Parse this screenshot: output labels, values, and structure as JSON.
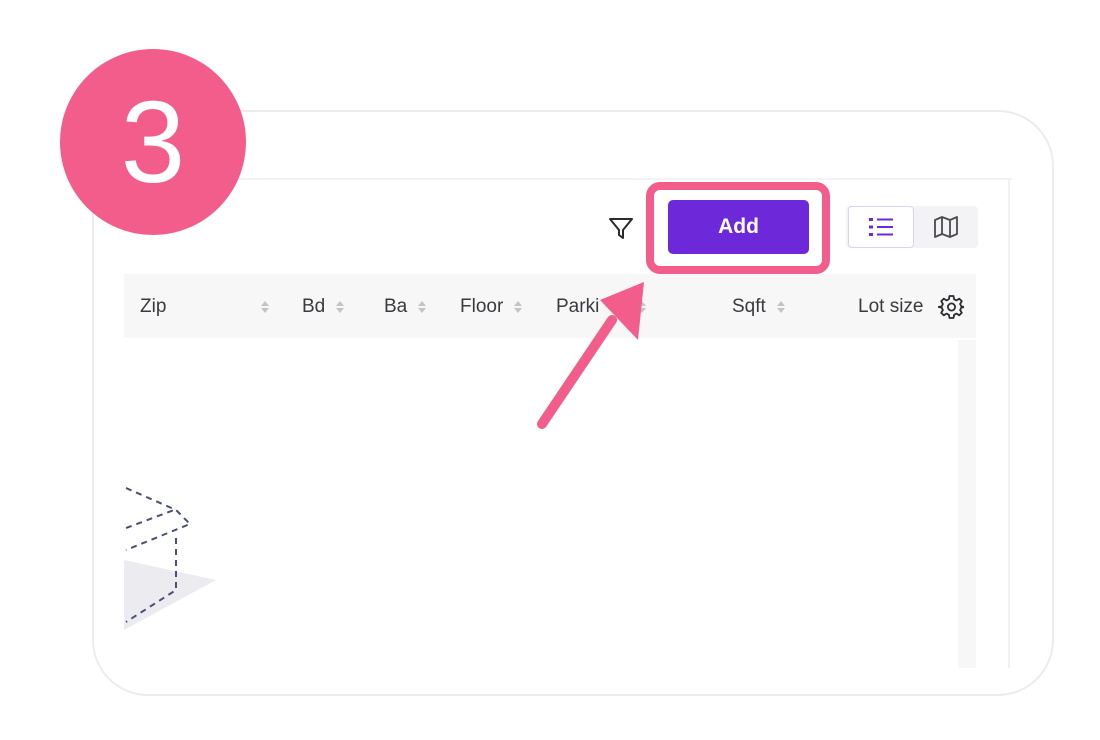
{
  "step": {
    "number": "3"
  },
  "toolbar": {
    "filter_icon": "filter-icon",
    "add_label": "Add",
    "views": [
      {
        "name": "list",
        "icon": "list-icon",
        "active": true
      },
      {
        "name": "map",
        "icon": "map-icon",
        "active": false
      }
    ]
  },
  "table": {
    "columns": [
      {
        "label": "Zip",
        "sortable": true
      },
      {
        "label": "Bd",
        "sortable": true
      },
      {
        "label": "Ba",
        "sortable": true
      },
      {
        "label": "Floor",
        "sortable": true
      },
      {
        "label": "Parki",
        "sortable": true
      },
      {
        "label": "Sqft",
        "sortable": true
      },
      {
        "label": "Lot size",
        "sortable": false
      }
    ],
    "settings_icon": "gear-icon",
    "rows": []
  },
  "colors": {
    "brand": "#6d28d9",
    "highlight": "#f25d8b"
  }
}
